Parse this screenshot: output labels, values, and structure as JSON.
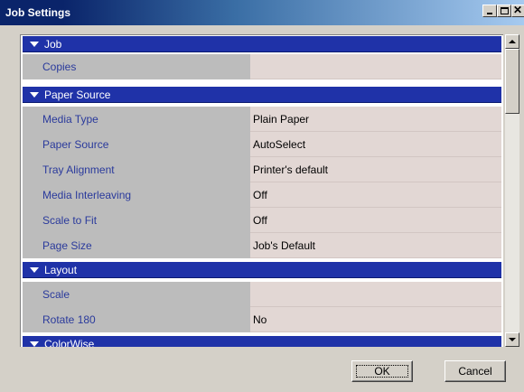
{
  "window": {
    "title": "Job Settings",
    "close_glyph": "✕"
  },
  "sections": {
    "job": {
      "label": "Job",
      "rows": [
        {
          "name": "Copies",
          "value": ""
        }
      ]
    },
    "paper_source": {
      "label": "Paper Source",
      "rows": [
        {
          "name": "Media Type",
          "value": "Plain Paper"
        },
        {
          "name": "Paper Source",
          "value": "AutoSelect"
        },
        {
          "name": "Tray Alignment",
          "value": "Printer's default"
        },
        {
          "name": "Media Interleaving",
          "value": "Off"
        },
        {
          "name": "Scale to Fit",
          "value": "Off"
        },
        {
          "name": "Page Size",
          "value": "Job's Default"
        }
      ]
    },
    "layout": {
      "label": "Layout",
      "rows": [
        {
          "name": "Scale",
          "value": ""
        },
        {
          "name": "Rotate 180",
          "value": "No"
        }
      ]
    },
    "colorwise": {
      "label": "ColorWise"
    }
  },
  "buttons": {
    "ok": "OK",
    "cancel": "Cancel"
  },
  "icons": {
    "expand": "triangle-down-icon",
    "minimize": "minimize-icon",
    "maximize": "maximize-icon",
    "close": "close-icon"
  },
  "colors": {
    "section_header": "#1f32a8",
    "label_text": "#2a3a9c",
    "label_column": "#bcbcbc",
    "value_column": "#e2d7d4"
  }
}
